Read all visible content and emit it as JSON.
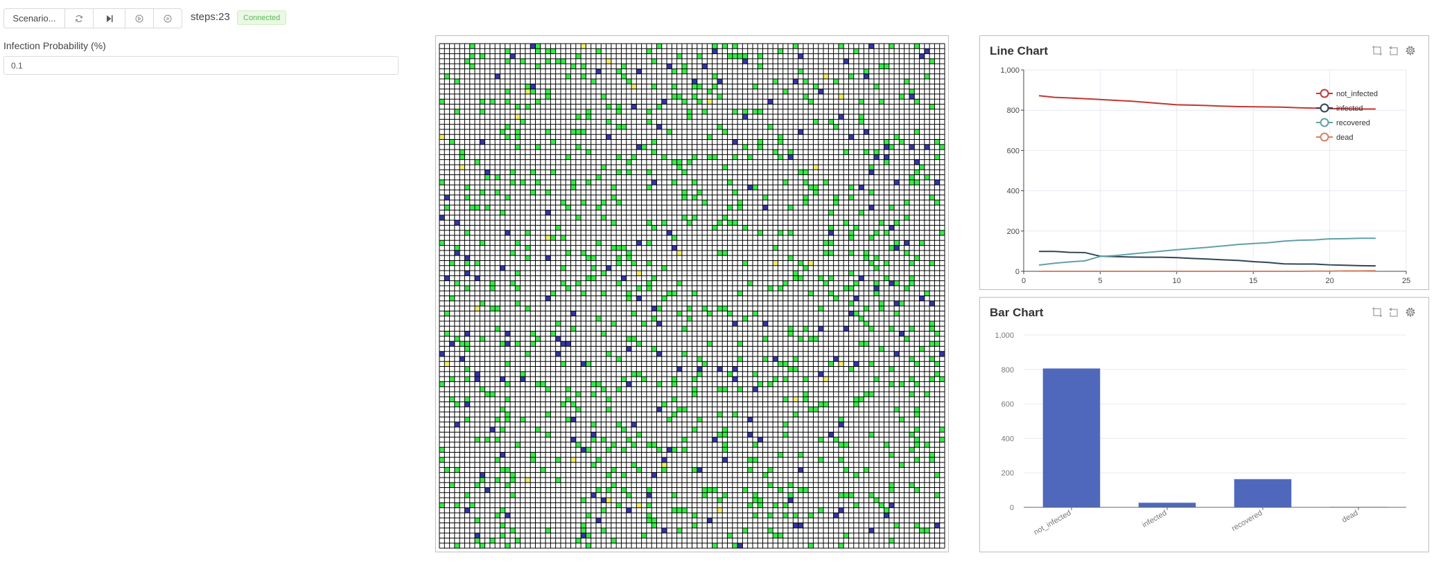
{
  "toolbar": {
    "scenario_label": "Scenario...",
    "buttons": [
      {
        "name": "reset",
        "icon": "refresh-icon"
      },
      {
        "name": "step",
        "icon": "step-forward-icon"
      },
      {
        "name": "play",
        "icon": "play-circle-icon"
      },
      {
        "name": "pause",
        "icon": "pause-circle-icon"
      }
    ],
    "steps_text": "steps:23",
    "status_badge": "Connected"
  },
  "parameters": {
    "infection_probability": {
      "label": "Infection Probability (%)",
      "value": "0.1"
    }
  },
  "grid": {
    "columns": 100,
    "rows": 100,
    "agent_counts": {
      "not_infected": 806,
      "infected": 27,
      "recovered": 164,
      "dead": 3
    },
    "colors": {
      "not_infected": "#33ee44",
      "infected": "#f5ee5a",
      "recovered": "#3333aa",
      "empty": "#ffffff",
      "grid_line": "#000000"
    }
  },
  "line_panel": {
    "title": "Line Chart",
    "tools": [
      "zoom-icon",
      "zoom-reset-icon",
      "settings-gear-icon"
    ]
  },
  "bar_panel": {
    "title": "Bar Chart",
    "tools": [
      "zoom-icon",
      "zoom-reset-icon",
      "settings-gear-icon"
    ]
  },
  "chart_data": [
    {
      "type": "line",
      "title": "Line Chart",
      "xlabel": "",
      "ylabel": "",
      "xlim": [
        0,
        25
      ],
      "ylim": [
        0,
        1000
      ],
      "x_ticks": [
        0,
        5,
        10,
        15,
        20,
        25
      ],
      "y_ticks": [
        0,
        200,
        400,
        600,
        800,
        1000
      ],
      "y_tick_labels": [
        "0",
        "200",
        "400",
        "600",
        "800",
        "1,000"
      ],
      "grid": true,
      "legend_position": "top-right",
      "x": [
        1,
        2,
        3,
        4,
        5,
        6,
        7,
        8,
        9,
        10,
        11,
        12,
        13,
        14,
        15,
        16,
        17,
        18,
        19,
        20,
        21,
        22,
        23
      ],
      "series": [
        {
          "name": "not_infected",
          "color": "#c23531",
          "values": [
            872,
            864,
            861,
            857,
            853,
            849,
            845,
            839,
            833,
            827,
            825,
            823,
            820,
            818,
            817,
            816,
            815,
            812,
            810,
            808,
            807,
            806,
            806
          ]
        },
        {
          "name": "infected",
          "color": "#2f4554",
          "values": [
            99,
            99,
            94,
            93,
            75,
            73,
            71,
            70,
            70,
            68,
            64,
            61,
            57,
            54,
            48,
            44,
            37,
            36,
            36,
            32,
            30,
            28,
            27
          ]
        },
        {
          "name": "recovered",
          "color": "#61a0a8",
          "values": [
            31,
            40,
            47,
            52,
            74,
            78,
            86,
            93,
            100,
            107,
            113,
            119,
            126,
            133,
            138,
            142,
            150,
            154,
            156,
            161,
            162,
            164,
            164
          ]
        },
        {
          "name": "dead",
          "color": "#d48265",
          "values": [
            0,
            0,
            0,
            0,
            0,
            0,
            0,
            0,
            0,
            0,
            0,
            0,
            0,
            0,
            0,
            0,
            0,
            0,
            1,
            1,
            2,
            2,
            3
          ]
        }
      ]
    },
    {
      "type": "bar",
      "title": "Bar Chart",
      "categories": [
        "not_infected",
        "infected",
        "recovered",
        "dead"
      ],
      "values": [
        806,
        27,
        164,
        3
      ],
      "ylim": [
        0,
        1000
      ],
      "y_ticks": [
        0,
        200,
        400,
        600,
        800,
        1000
      ],
      "y_tick_labels": [
        "0",
        "200",
        "400",
        "600",
        "800",
        "1,000"
      ],
      "grid": true,
      "bar_color": "#4f68bb",
      "xlabel": "",
      "ylabel": ""
    }
  ]
}
